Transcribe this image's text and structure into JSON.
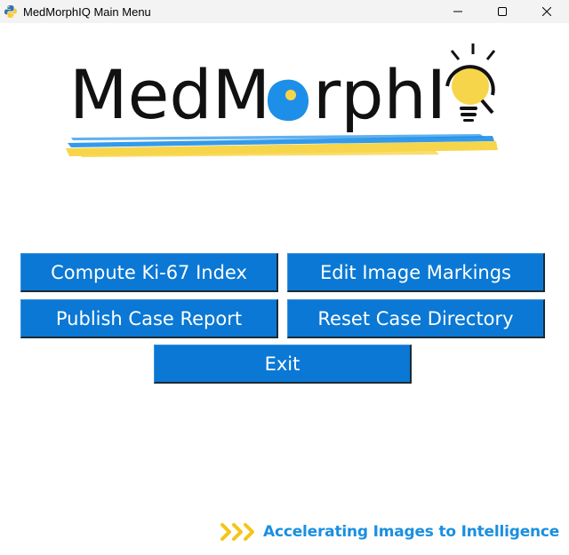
{
  "window": {
    "title": "MedMorphIQ Main Menu",
    "app_icon": "python-icon",
    "controls": [
      "minimize-icon",
      "maximize-icon",
      "close-icon"
    ]
  },
  "logo": {
    "text_left": "MedM",
    "text_right": "rphI",
    "colors": {
      "text": "#111111",
      "accent_blue": "#1e8fe8",
      "accent_yellow": "#f7d54a"
    }
  },
  "buttons": {
    "compute_ki67": "Compute Ki-67 Index",
    "edit_markings": "Edit Image Markings",
    "publish_report": "Publish Case Report",
    "reset_directory": "Reset Case Directory",
    "exit": "Exit"
  },
  "tagline": {
    "text": "Accelerating Images to Intelligence",
    "icon": "triple-chevron-icon"
  },
  "colors": {
    "button_bg": "#0a78d4",
    "button_text": "#ffffff",
    "tagline": "#1a8fe0",
    "chevrons": "#f5c518"
  }
}
